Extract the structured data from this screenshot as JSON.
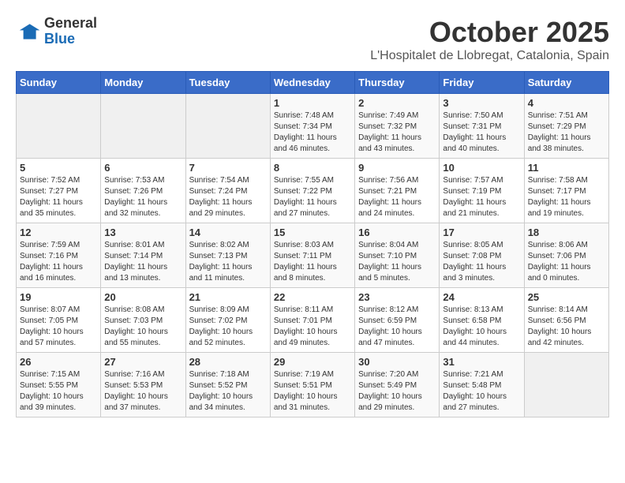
{
  "logo": {
    "general": "General",
    "blue": "Blue"
  },
  "header": {
    "month": "October 2025",
    "location": "L'Hospitalet de Llobregat, Catalonia, Spain"
  },
  "weekdays": [
    "Sunday",
    "Monday",
    "Tuesday",
    "Wednesday",
    "Thursday",
    "Friday",
    "Saturday"
  ],
  "weeks": [
    [
      {
        "day": "",
        "info": ""
      },
      {
        "day": "",
        "info": ""
      },
      {
        "day": "",
        "info": ""
      },
      {
        "day": "1",
        "info": "Sunrise: 7:48 AM\nSunset: 7:34 PM\nDaylight: 11 hours\nand 46 minutes."
      },
      {
        "day": "2",
        "info": "Sunrise: 7:49 AM\nSunset: 7:32 PM\nDaylight: 11 hours\nand 43 minutes."
      },
      {
        "day": "3",
        "info": "Sunrise: 7:50 AM\nSunset: 7:31 PM\nDaylight: 11 hours\nand 40 minutes."
      },
      {
        "day": "4",
        "info": "Sunrise: 7:51 AM\nSunset: 7:29 PM\nDaylight: 11 hours\nand 38 minutes."
      }
    ],
    [
      {
        "day": "5",
        "info": "Sunrise: 7:52 AM\nSunset: 7:27 PM\nDaylight: 11 hours\nand 35 minutes."
      },
      {
        "day": "6",
        "info": "Sunrise: 7:53 AM\nSunset: 7:26 PM\nDaylight: 11 hours\nand 32 minutes."
      },
      {
        "day": "7",
        "info": "Sunrise: 7:54 AM\nSunset: 7:24 PM\nDaylight: 11 hours\nand 29 minutes."
      },
      {
        "day": "8",
        "info": "Sunrise: 7:55 AM\nSunset: 7:22 PM\nDaylight: 11 hours\nand 27 minutes."
      },
      {
        "day": "9",
        "info": "Sunrise: 7:56 AM\nSunset: 7:21 PM\nDaylight: 11 hours\nand 24 minutes."
      },
      {
        "day": "10",
        "info": "Sunrise: 7:57 AM\nSunset: 7:19 PM\nDaylight: 11 hours\nand 21 minutes."
      },
      {
        "day": "11",
        "info": "Sunrise: 7:58 AM\nSunset: 7:17 PM\nDaylight: 11 hours\nand 19 minutes."
      }
    ],
    [
      {
        "day": "12",
        "info": "Sunrise: 7:59 AM\nSunset: 7:16 PM\nDaylight: 11 hours\nand 16 minutes."
      },
      {
        "day": "13",
        "info": "Sunrise: 8:01 AM\nSunset: 7:14 PM\nDaylight: 11 hours\nand 13 minutes."
      },
      {
        "day": "14",
        "info": "Sunrise: 8:02 AM\nSunset: 7:13 PM\nDaylight: 11 hours\nand 11 minutes."
      },
      {
        "day": "15",
        "info": "Sunrise: 8:03 AM\nSunset: 7:11 PM\nDaylight: 11 hours\nand 8 minutes."
      },
      {
        "day": "16",
        "info": "Sunrise: 8:04 AM\nSunset: 7:10 PM\nDaylight: 11 hours\nand 5 minutes."
      },
      {
        "day": "17",
        "info": "Sunrise: 8:05 AM\nSunset: 7:08 PM\nDaylight: 11 hours\nand 3 minutes."
      },
      {
        "day": "18",
        "info": "Sunrise: 8:06 AM\nSunset: 7:06 PM\nDaylight: 11 hours\nand 0 minutes."
      }
    ],
    [
      {
        "day": "19",
        "info": "Sunrise: 8:07 AM\nSunset: 7:05 PM\nDaylight: 10 hours\nand 57 minutes."
      },
      {
        "day": "20",
        "info": "Sunrise: 8:08 AM\nSunset: 7:03 PM\nDaylight: 10 hours\nand 55 minutes."
      },
      {
        "day": "21",
        "info": "Sunrise: 8:09 AM\nSunset: 7:02 PM\nDaylight: 10 hours\nand 52 minutes."
      },
      {
        "day": "22",
        "info": "Sunrise: 8:11 AM\nSunset: 7:01 PM\nDaylight: 10 hours\nand 49 minutes."
      },
      {
        "day": "23",
        "info": "Sunrise: 8:12 AM\nSunset: 6:59 PM\nDaylight: 10 hours\nand 47 minutes."
      },
      {
        "day": "24",
        "info": "Sunrise: 8:13 AM\nSunset: 6:58 PM\nDaylight: 10 hours\nand 44 minutes."
      },
      {
        "day": "25",
        "info": "Sunrise: 8:14 AM\nSunset: 6:56 PM\nDaylight: 10 hours\nand 42 minutes."
      }
    ],
    [
      {
        "day": "26",
        "info": "Sunrise: 7:15 AM\nSunset: 5:55 PM\nDaylight: 10 hours\nand 39 minutes."
      },
      {
        "day": "27",
        "info": "Sunrise: 7:16 AM\nSunset: 5:53 PM\nDaylight: 10 hours\nand 37 minutes."
      },
      {
        "day": "28",
        "info": "Sunrise: 7:18 AM\nSunset: 5:52 PM\nDaylight: 10 hours\nand 34 minutes."
      },
      {
        "day": "29",
        "info": "Sunrise: 7:19 AM\nSunset: 5:51 PM\nDaylight: 10 hours\nand 31 minutes."
      },
      {
        "day": "30",
        "info": "Sunrise: 7:20 AM\nSunset: 5:49 PM\nDaylight: 10 hours\nand 29 minutes."
      },
      {
        "day": "31",
        "info": "Sunrise: 7:21 AM\nSunset: 5:48 PM\nDaylight: 10 hours\nand 27 minutes."
      },
      {
        "day": "",
        "info": ""
      }
    ]
  ]
}
